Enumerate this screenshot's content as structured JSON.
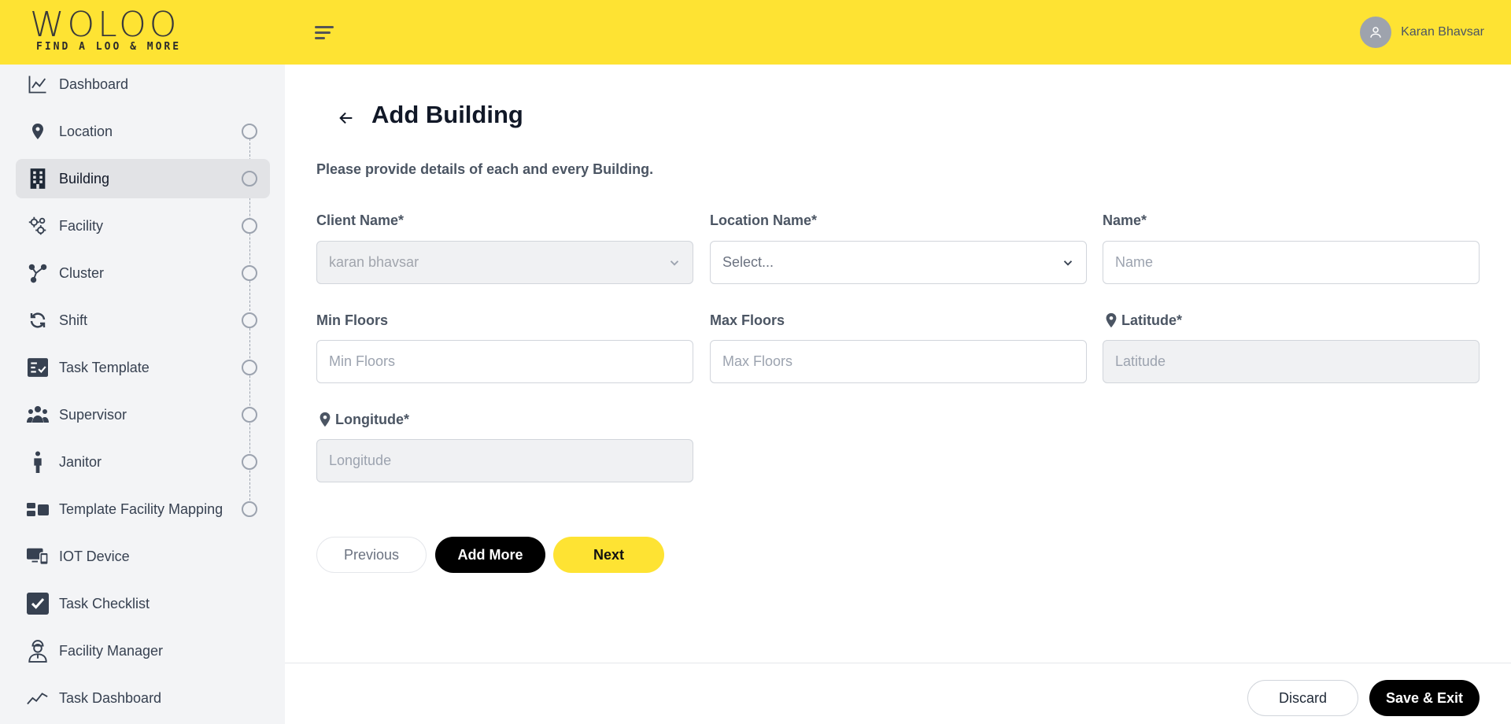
{
  "header": {
    "logo_text": "WOLOO",
    "logo_tagline": "FIND A LOO & MORE",
    "user_name": "Karan Bhavsar"
  },
  "sidebar": {
    "items": [
      {
        "label": "Dashboard",
        "icon": "line-chart-icon",
        "active": false,
        "step": false
      },
      {
        "label": "Location",
        "icon": "map-pin-icon",
        "active": false,
        "step": true
      },
      {
        "label": "Building",
        "icon": "building-icon",
        "active": true,
        "step": true
      },
      {
        "label": "Facility",
        "icon": "gears-icon",
        "active": false,
        "step": true
      },
      {
        "label": "Cluster",
        "icon": "cluster-icon",
        "active": false,
        "step": true
      },
      {
        "label": "Shift",
        "icon": "refresh-icon",
        "active": false,
        "step": true
      },
      {
        "label": "Task Template",
        "icon": "checklist-icon",
        "active": false,
        "step": true
      },
      {
        "label": "Supervisor",
        "icon": "users-icon",
        "active": false,
        "step": true
      },
      {
        "label": "Janitor",
        "icon": "person-icon",
        "active": false,
        "step": true
      },
      {
        "label": "Template Facility Mapping",
        "icon": "mapping-icon",
        "active": false,
        "step": true
      },
      {
        "label": "IOT Device",
        "icon": "devices-icon",
        "active": false,
        "step": false
      },
      {
        "label": "Task Checklist",
        "icon": "check-square-icon",
        "active": false,
        "step": false
      },
      {
        "label": "Facility Manager",
        "icon": "manager-icon",
        "active": false,
        "step": false
      },
      {
        "label": "Task Dashboard",
        "icon": "trend-icon",
        "active": false,
        "step": false
      }
    ]
  },
  "main": {
    "title": "Add Building",
    "subtitle": "Please provide details of each and every Building.",
    "fields": {
      "client_name": {
        "label": "Client Name*",
        "value": "karan bhavsar"
      },
      "location_name": {
        "label": "Location Name*",
        "value": "Select..."
      },
      "name": {
        "label": "Name*",
        "placeholder": "Name"
      },
      "min_floors": {
        "label": "Min Floors",
        "placeholder": "Min Floors"
      },
      "max_floors": {
        "label": "Max Floors",
        "placeholder": "Max Floors"
      },
      "latitude": {
        "label": "Latitude*",
        "placeholder": "Latitude"
      },
      "longitude": {
        "label": "Longitude*",
        "placeholder": "Longitude"
      }
    },
    "buttons": {
      "previous": "Previous",
      "add_more": "Add More",
      "next": "Next"
    }
  },
  "footer": {
    "discard": "Discard",
    "save_exit": "Save & Exit"
  },
  "colors": {
    "brand_yellow": "#fee333",
    "sidebar_bg": "#f3f4f6",
    "active_item_bg": "#e2e3e6",
    "primary_black": "#000000"
  }
}
